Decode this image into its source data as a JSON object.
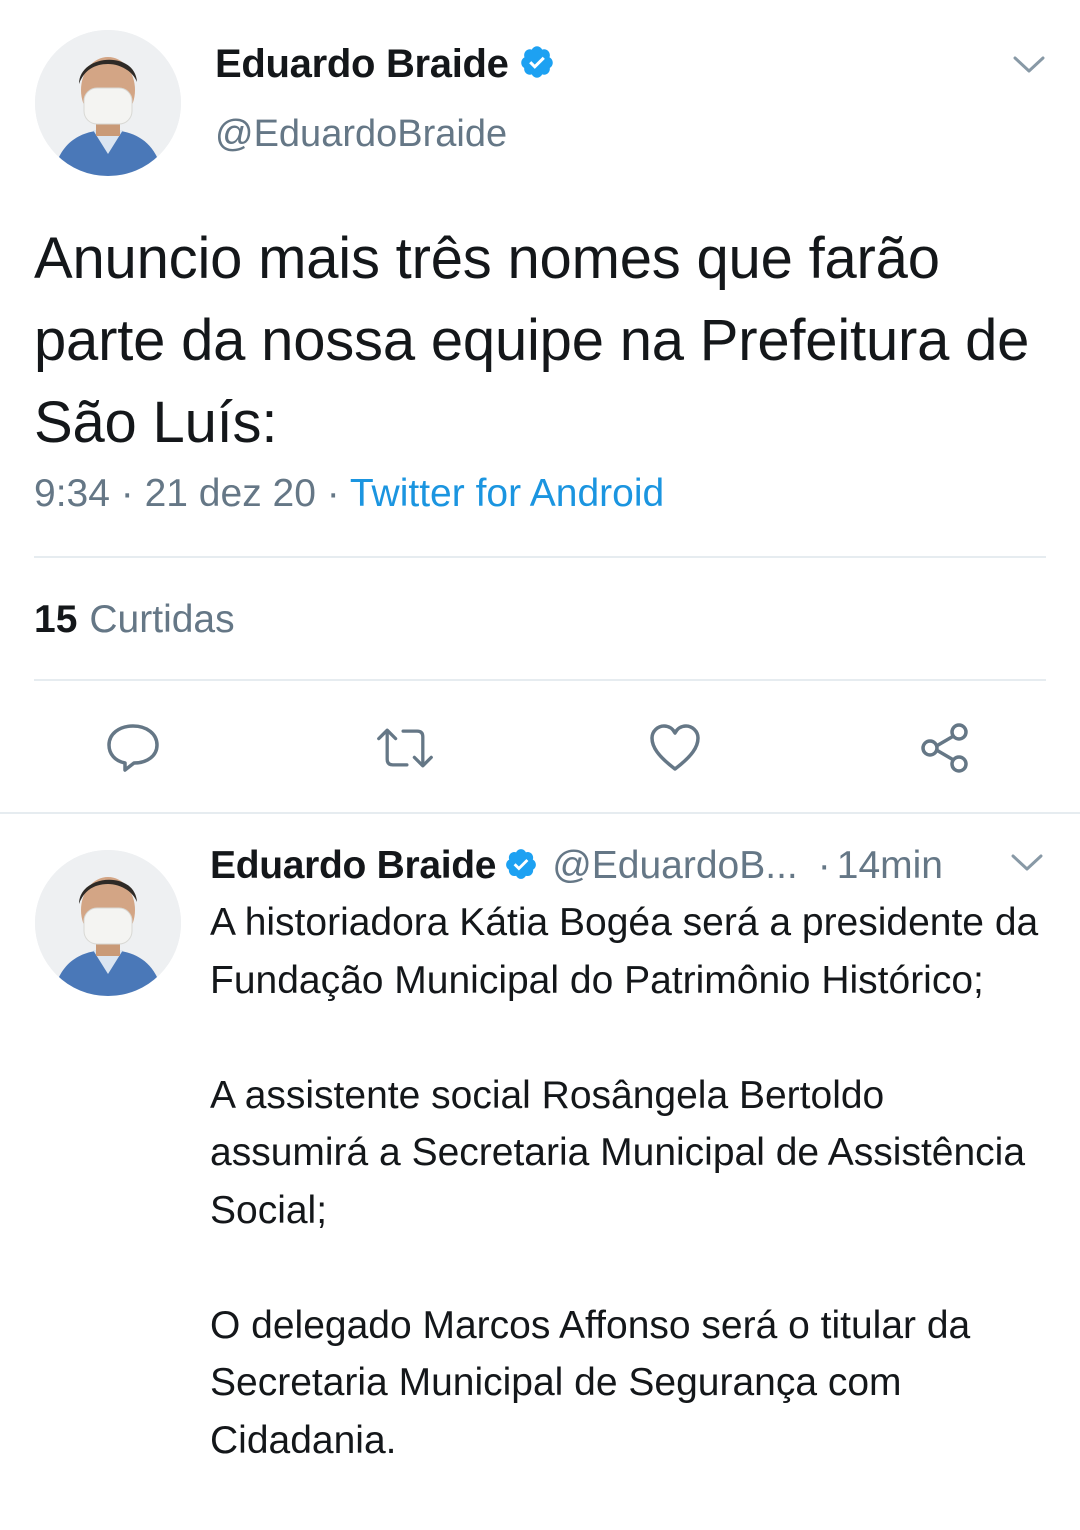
{
  "main_tweet": {
    "author_name": "Eduardo Braide",
    "author_handle": "@EduardoBraide",
    "verified": true,
    "text": "Anuncio mais três nomes que farão parte da nossa equipe na Prefeitura de São Luís:",
    "time": "9:34",
    "date": "21 dez 20",
    "separator": "·",
    "source": "Twitter for Android",
    "likes_count": "15",
    "likes_label": "Curtidas",
    "actions": [
      "reply-icon",
      "retweet-icon",
      "heart-icon",
      "share-icon"
    ]
  },
  "reply_tweet": {
    "author_name": "Eduardo Braide",
    "author_handle": "@EduardoB...",
    "verified": true,
    "separator": "·",
    "time_ago": "14min",
    "paragraphs": [
      "A historiadora Kátia Bogéa será a presidente da Fundação Municipal do Patrimônio Histórico;",
      "A assistente social Rosângela Bertoldo assumirá a Secretaria Municipal de Assistência Social;",
      "O delegado Marcos Affonso será o titular da Secretaria Municipal de Segurança com Cidadania."
    ]
  },
  "colors": {
    "text_primary": "#14171a",
    "text_secondary": "#657786",
    "link": "#1b95e0",
    "verified_badge": "#1da1f2",
    "divider": "#e6ecf0"
  }
}
